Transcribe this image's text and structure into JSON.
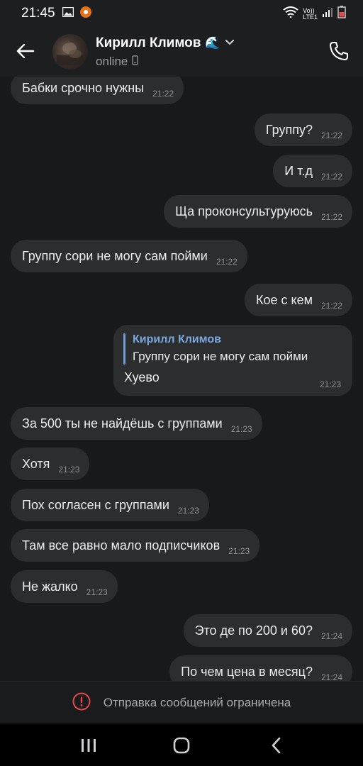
{
  "status_bar": {
    "time": "21:45",
    "icons": [
      "image-icon",
      "notification-badge-icon"
    ],
    "right_icons": [
      "wifi-icon",
      "volte-icon",
      "signal-icon",
      "battery-icon"
    ],
    "volte_label": "Vo))",
    "lte_label": "LTE1"
  },
  "header": {
    "contact_name": "Кирилл Климов",
    "emoji": "🌊",
    "status": "online"
  },
  "messages": [
    {
      "dir": "in",
      "text": "Бабки срочно нужны",
      "time": "21:22"
    },
    {
      "dir": "out",
      "text": "Группу?",
      "time": "21:22"
    },
    {
      "dir": "out",
      "text": "И т.д",
      "time": "21:22"
    },
    {
      "dir": "out",
      "text": "Ща проконсультуруюсь",
      "time": "21:22"
    },
    {
      "dir": "in",
      "text": "Группу сори не могу сам пойми",
      "time": "21:22"
    },
    {
      "dir": "out",
      "text": "Кое с кем",
      "time": "21:22"
    },
    {
      "dir": "in",
      "text": "За 500 ты не найдёшь с группами",
      "time": "21:23"
    },
    {
      "dir": "in",
      "text": "Хотя",
      "time": "21:23"
    },
    {
      "dir": "in",
      "text": "Пох согласен с группами",
      "time": "21:23"
    },
    {
      "dir": "in",
      "text": "Там все равно мало подписчиков",
      "time": "21:23"
    },
    {
      "dir": "in",
      "text": "Не жалко",
      "time": "21:23"
    },
    {
      "dir": "out",
      "text": "Это де по 200 и 60?",
      "time": "21:24"
    },
    {
      "dir": "out",
      "text": "По чем цена в месяц?",
      "time": "21:24"
    }
  ],
  "reply_message": {
    "quote_author": "Кирилл Климов",
    "quote_text": "Группу сори не могу сам пойми",
    "text": "Хуево",
    "time": "21:23"
  },
  "restriction": {
    "label": "Отправка сообщений ограничена"
  },
  "colors": {
    "background": "#18191b",
    "bubble": "#2c2d2f",
    "accent": "#7aa9e0",
    "warning": "#e5484d"
  }
}
